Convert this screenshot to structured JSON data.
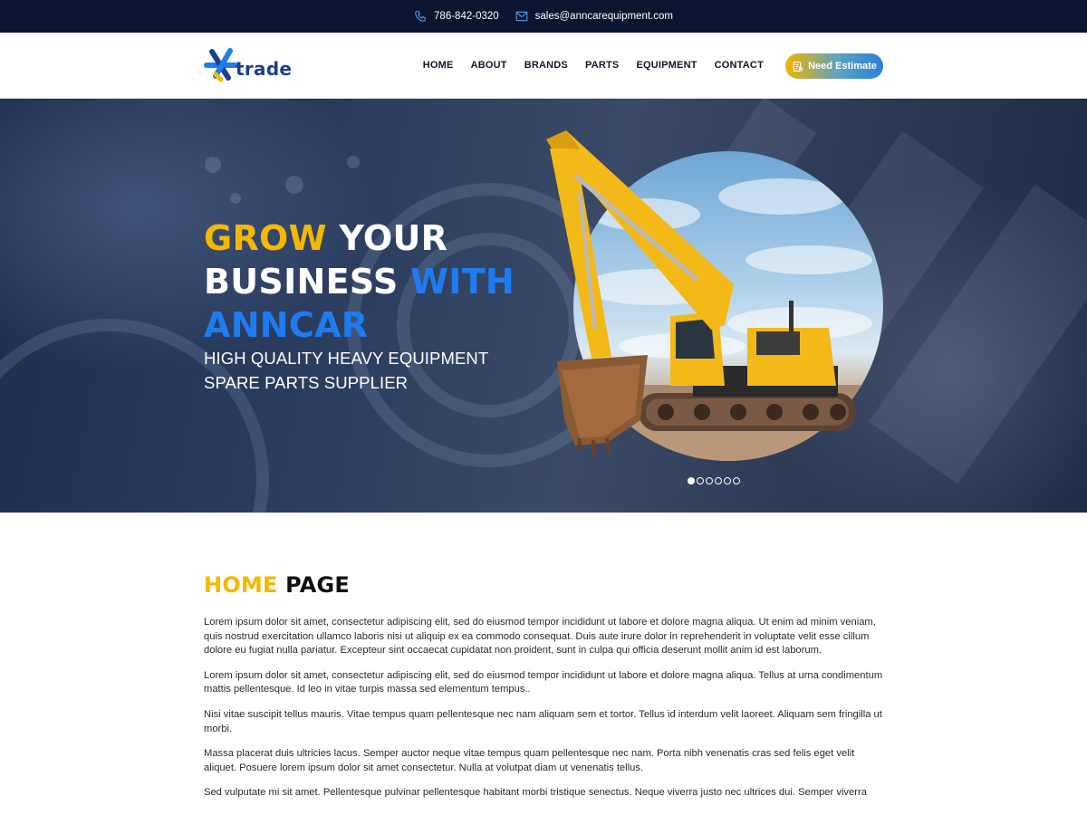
{
  "topbar": {
    "phone": "786-842-0320",
    "email": "sales@anncarequipment.com",
    "icons": [
      "phone-icon",
      "mail-icon"
    ]
  },
  "header": {
    "logo_text": "trade",
    "logo_tagline": "",
    "nav": [
      "HOME",
      "ABOUT",
      "BRANDS",
      "PARTS",
      "EQUIPMENT",
      "CONTACT"
    ],
    "cta_label": "Need Estimate"
  },
  "hero": {
    "title_line1_accent": "GROW",
    "title_line1_rest": " YOUR",
    "title_line2_plain": "BUSINESS ",
    "title_line2_accent": "WITH",
    "title_line3_accent": "ANNCAR",
    "subtitle": "HIGH QUALITY HEAVY EQUIPMENT SPARE PARTS SUPPLIER",
    "slides_total": 6,
    "slide_active": 1
  },
  "main": {
    "heading_accent": "HOME",
    "heading_rest": " PAGE",
    "paragraphs": [
      "Lorem ipsum dolor sit amet, consectetur adipiscing elit, sed do eiusmod tempor incididunt ut labore et dolore magna aliqua. Ut enim ad minim veniam, quis nostrud exercitation ullamco laboris nisi ut aliquip ex ea commodo consequat. Duis aute irure dolor in reprehenderit in voluptate velit esse cillum dolore eu fugiat nulla pariatur. Excepteur sint occaecat cupidatat non proident, sunt in culpa qui officia deserunt mollit anim id est laborum.",
      "Lorem ipsum dolor sit amet, consectetur adipiscing elit, sed do eiusmod tempor incididunt ut labore et dolore magna aliqua. Tellus at urna condimentum mattis pellentesque. Id leo in vitae turpis massa sed elementum tempus..",
      "Nisi vitae suscipit tellus mauris. Vitae tempus quam pellentesque nec nam aliquam sem et tortor. Tellus id interdum velit laoreet. Aliquam sem fringilla ut morbi.",
      "Massa placerat duis ultricies lacus. Semper auctor neque vitae tempus quam pellentesque nec nam. Porta nibh venenatis cras sed felis eget velit aliquet. Posuere lorem ipsum dolor sit amet consectetur. Nulla at volutpat diam ut venenatis tellus.",
      "Sed vulputate mi sit amet. Pellentesque pulvinar pellentesque habitant morbi tristique senectus. Neque viverra justo nec ultrices dui. Semper viverra"
    ]
  },
  "colors": {
    "topbar_bg": "#0c1530",
    "accent_yellow": "#f5b800",
    "accent_blue": "#1f7cf0",
    "text_dark": "#111111"
  }
}
